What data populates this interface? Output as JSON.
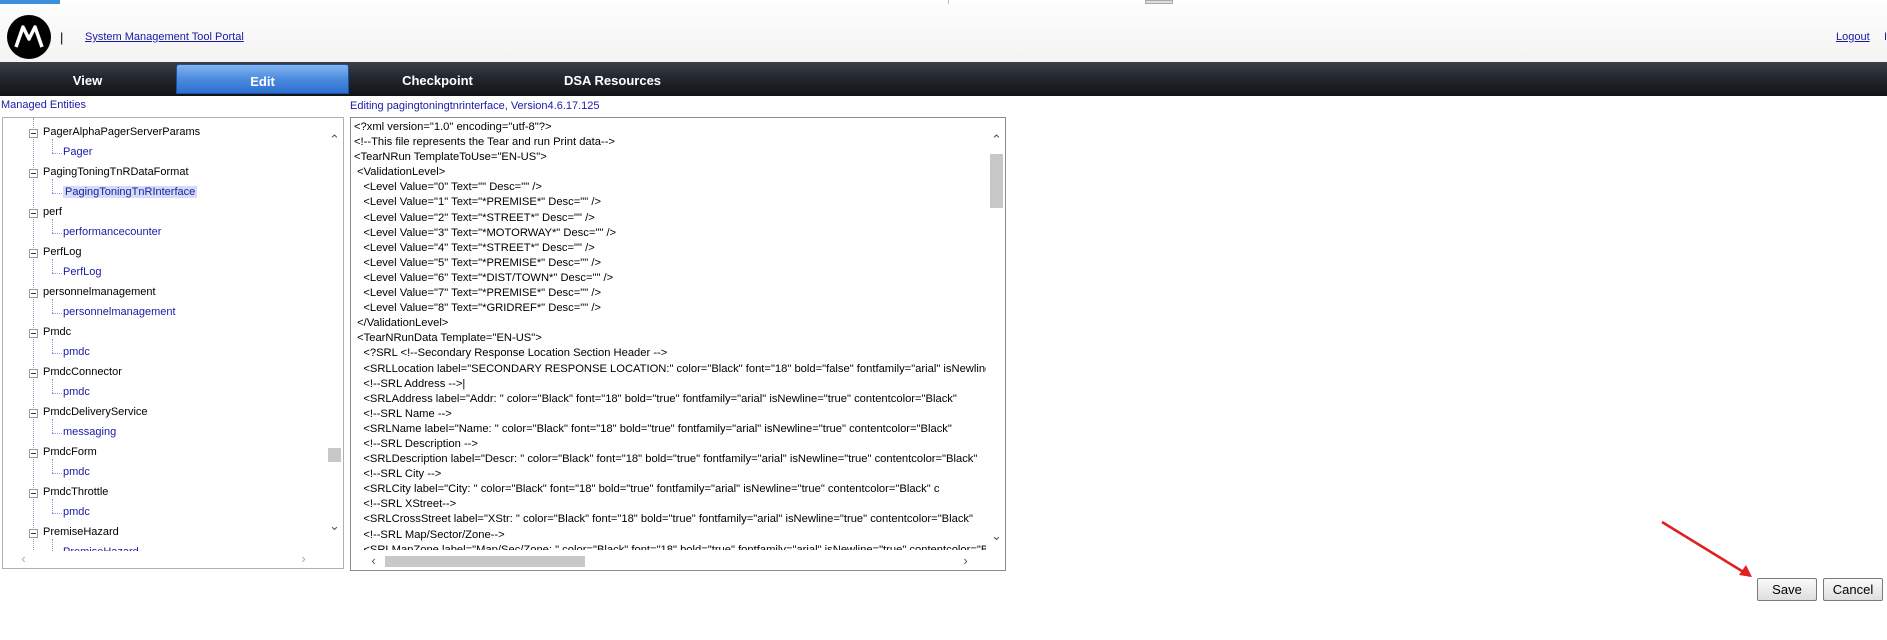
{
  "header": {
    "separator": "|",
    "portal_link": "System Management Tool Portal",
    "logout_link": "Logout",
    "logout_trailing": "I"
  },
  "nav": {
    "tabs": [
      "View",
      "Edit",
      "Checkpoint",
      "DSA Resources"
    ],
    "active_tab": "Edit"
  },
  "tree": {
    "title": "Managed Entities",
    "items": [
      {
        "parent": "PagerAlphaPagerServerParams",
        "child": "Pager"
      },
      {
        "parent": "PagingToningTnRDataFormat",
        "child": "PagingToningTnRInterface",
        "selected": true
      },
      {
        "parent": "perf",
        "child": "performancecounter"
      },
      {
        "parent": "PerfLog",
        "child": "PerfLog"
      },
      {
        "parent": "personnelmanagement",
        "child": "personnelmanagement"
      },
      {
        "parent": "Pmdc",
        "child": "pmdc"
      },
      {
        "parent": "PmdcConnector",
        "child": "pmdc"
      },
      {
        "parent": "PmdcDeliveryService",
        "child": "messaging"
      },
      {
        "parent": "PmdcForm",
        "child": "pmdc"
      },
      {
        "parent": "PmdcThrottle",
        "child": "pmdc"
      },
      {
        "parent": "PremiseHazard",
        "child": "PremiseHazard"
      }
    ]
  },
  "editor": {
    "title": "Editing pagingtoningtnrinterface, Version4.6.17.125",
    "lines": [
      "<?xml version=\"1.0\" encoding=\"utf-8\"?>",
      "<!--This file represents the Tear and run Print data-->",
      "<TearNRun TemplateToUse=\"EN-US\">",
      " <ValidationLevel>",
      "   <Level Value=\"0\" Text=\"\" Desc=\"\" />",
      "   <Level Value=\"1\" Text=\"*PREMISE*\" Desc=\"\" />",
      "   <Level Value=\"2\" Text=\"*STREET*\" Desc=\"\" />",
      "   <Level Value=\"3\" Text=\"*MOTORWAY*\" Desc=\"\" />",
      "   <Level Value=\"4\" Text=\"*STREET*\" Desc=\"\" />",
      "   <Level Value=\"5\" Text=\"*PREMISE*\" Desc=\"\" />",
      "   <Level Value=\"6\" Text=\"*DIST/TOWN*\" Desc=\"\" />",
      "   <Level Value=\"7\" Text=\"*PREMISE*\" Desc=\"\" />",
      "   <Level Value=\"8\" Text=\"*GRIDREF*\" Desc=\"\" />",
      " </ValidationLevel>",
      " <TearNRunData Template=\"EN-US\">",
      "   <?SRL <!--Secondary Response Location Section Header -->",
      "   <SRLLocation label=\"SECONDARY RESPONSE LOCATION:\" color=\"Black\" font=\"18\" bold=\"false\" fontfamily=\"arial\" isNewline=\"true\"",
      "   <!--SRL Address -->|",
      "   <SRLAddress label=\"Addr: \" color=\"Black\" font=\"18\" bold=\"true\" fontfamily=\"arial\" isNewline=\"true\" contentcolor=\"Black\"",
      "   <!--SRL Name -->",
      "   <SRLName label=\"Name: \" color=\"Black\" font=\"18\" bold=\"true\" fontfamily=\"arial\" isNewline=\"true\" contentcolor=\"Black\"",
      "   <!--SRL Description -->",
      "   <SRLDescription label=\"Descr: \" color=\"Black\" font=\"18\" bold=\"true\" fontfamily=\"arial\" isNewline=\"true\" contentcolor=\"Black\"",
      "   <!--SRL City -->",
      "   <SRLCity label=\"City: \" color=\"Black\" font=\"18\" bold=\"true\" fontfamily=\"arial\" isNewline=\"true\" contentcolor=\"Black\" c",
      "   <!--SRL XStreet-->",
      "   <SRLCrossStreet label=\"XStr: \" color=\"Black\" font=\"18\" bold=\"true\" fontfamily=\"arial\" isNewline=\"true\" contentcolor=\"Black\"",
      "   <!--SRL Map/Sector/Zone-->",
      "   <SRLMapZone label=\"Map/Sec/Zone: \" color=\"Black\" font=\"18\" bold=\"true\" fontfamily=\"arial\" isNewline=\"true\" contentcolor=\"Black\""
    ]
  },
  "actions": {
    "save_label": "Save",
    "cancel_label": "Cancel"
  },
  "colors": {
    "link": "#1a1aa6",
    "annotation_arrow": "#e02020",
    "active_tab": "#4f8fe0"
  }
}
